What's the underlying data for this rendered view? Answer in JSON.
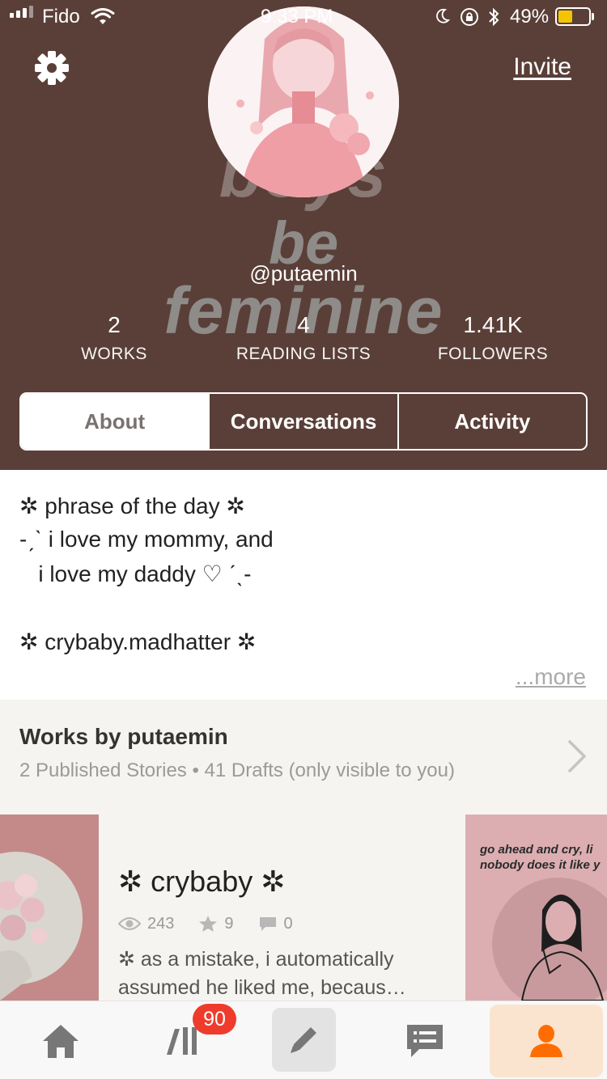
{
  "status_bar": {
    "carrier": "Fido",
    "time": "9:33 PM",
    "battery": "49%"
  },
  "header": {
    "invite_label": "Invite",
    "background_words": [
      "boys",
      "be",
      "feminine"
    ],
    "username": "@putaemin",
    "stats": [
      {
        "value": "2",
        "label": "WORKS"
      },
      {
        "value": "4",
        "label": "READING LISTS"
      },
      {
        "value": "1.41K",
        "label": "FOLLOWERS"
      }
    ],
    "tabs": [
      {
        "label": "About",
        "active": true
      },
      {
        "label": "Conversations",
        "active": false
      },
      {
        "label": "Activity",
        "active": false
      }
    ],
    "colors": {
      "header_bg": "#5a3f38",
      "battery": "#f5c400"
    }
  },
  "about": {
    "lines": [
      "✲ phrase of the day ✲",
      "-ˏˋ i love my mommy, and",
      "   i love my daddy ♡ ˊˎ-",
      "",
      "✲ crybaby.madhatter ✲"
    ],
    "more_label": "...more"
  },
  "works": {
    "title": "Works by putaemin",
    "subtitle": "2 Published Stories • 41 Drafts (only visible to you)"
  },
  "story": {
    "title": "✲ crybaby ✲",
    "reads": "243",
    "votes": "9",
    "comments": "0",
    "description": "✲ as a mistake,  i automatically assumed he  liked me, becaus…"
  },
  "cover_right": {
    "text": "go ahead and cry, li\nnobody does it like y"
  },
  "bottom_nav": {
    "badge": "90",
    "items": [
      "home",
      "library",
      "write",
      "messages",
      "profile"
    ],
    "active": "profile",
    "accent": "#ff6d00"
  }
}
